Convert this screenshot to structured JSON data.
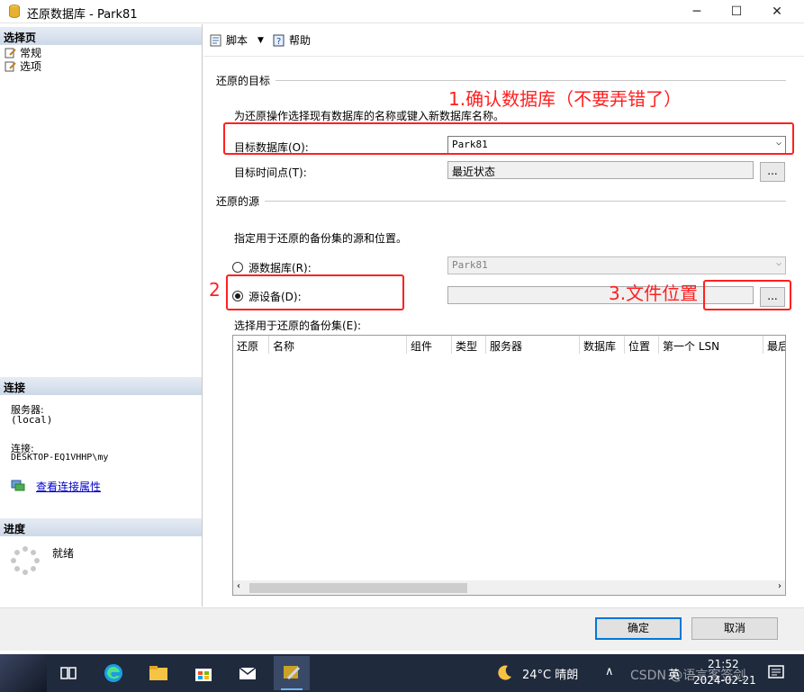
{
  "window": {
    "title": "还原数据库 - Park81",
    "minimize_glyph": "─",
    "maximize_glyph": "☐",
    "close_glyph": "✕"
  },
  "left_pane": {
    "select_page_header": "选择页",
    "pages": [
      {
        "label": "常规",
        "icon": "page-icon"
      },
      {
        "label": "选项",
        "icon": "page-icon"
      }
    ],
    "connection_header": "连接",
    "server_label": "服务器:",
    "server_value": "(local)",
    "connection_label": "连接:",
    "connection_value": "DESKTOP-EQ1VHHP\\my",
    "view_connection_link": "查看连接属性",
    "progress_header": "进度",
    "progress_status": "就绪"
  },
  "toolbar": {
    "script_label": "脚本",
    "help_label": "帮助"
  },
  "restore_target": {
    "group_label": "还原的目标",
    "instruction": "为还原操作选择现有数据库的名称或键入新数据库名称。",
    "target_db_label": "目标数据库(O):",
    "target_db_value": "Park81",
    "target_time_label": "目标时间点(T):",
    "target_time_value": "最近状态",
    "browse_label": "..."
  },
  "restore_source": {
    "group_label": "还原的源",
    "instruction": "指定用于还原的备份集的源和位置。",
    "source_db_label": "源数据库(R):",
    "source_db_value": "Park81",
    "source_device_label": "源设备(D):",
    "source_device_value": "",
    "browse_label": "...",
    "selected_option": "source_device"
  },
  "backup_sets": {
    "label": "选择用于还原的备份集(E):",
    "columns": [
      "还原",
      "名称",
      "组件",
      "类型",
      "服务器",
      "数据库",
      "位置",
      "第一个 LSN",
      "最后"
    ]
  },
  "buttons": {
    "ok": "确定",
    "cancel": "取消"
  },
  "annotations": {
    "note1": "1.确认数据库（不要弄错了）",
    "note2": "2",
    "note3": "3.文件位置"
  },
  "taskbar": {
    "weather": "24°C 晴朗",
    "language": "英",
    "time": "21:52",
    "date": "2024-02-21",
    "watermark": "CSDN @语言客签剑"
  },
  "colors": {
    "annotation_red": "#ff2020",
    "header_gradient_top": "#e6ecf4",
    "header_gradient_bottom": "#cdd9e8",
    "link_blue": "#0000cc",
    "taskbar": "#1f2a3d"
  }
}
